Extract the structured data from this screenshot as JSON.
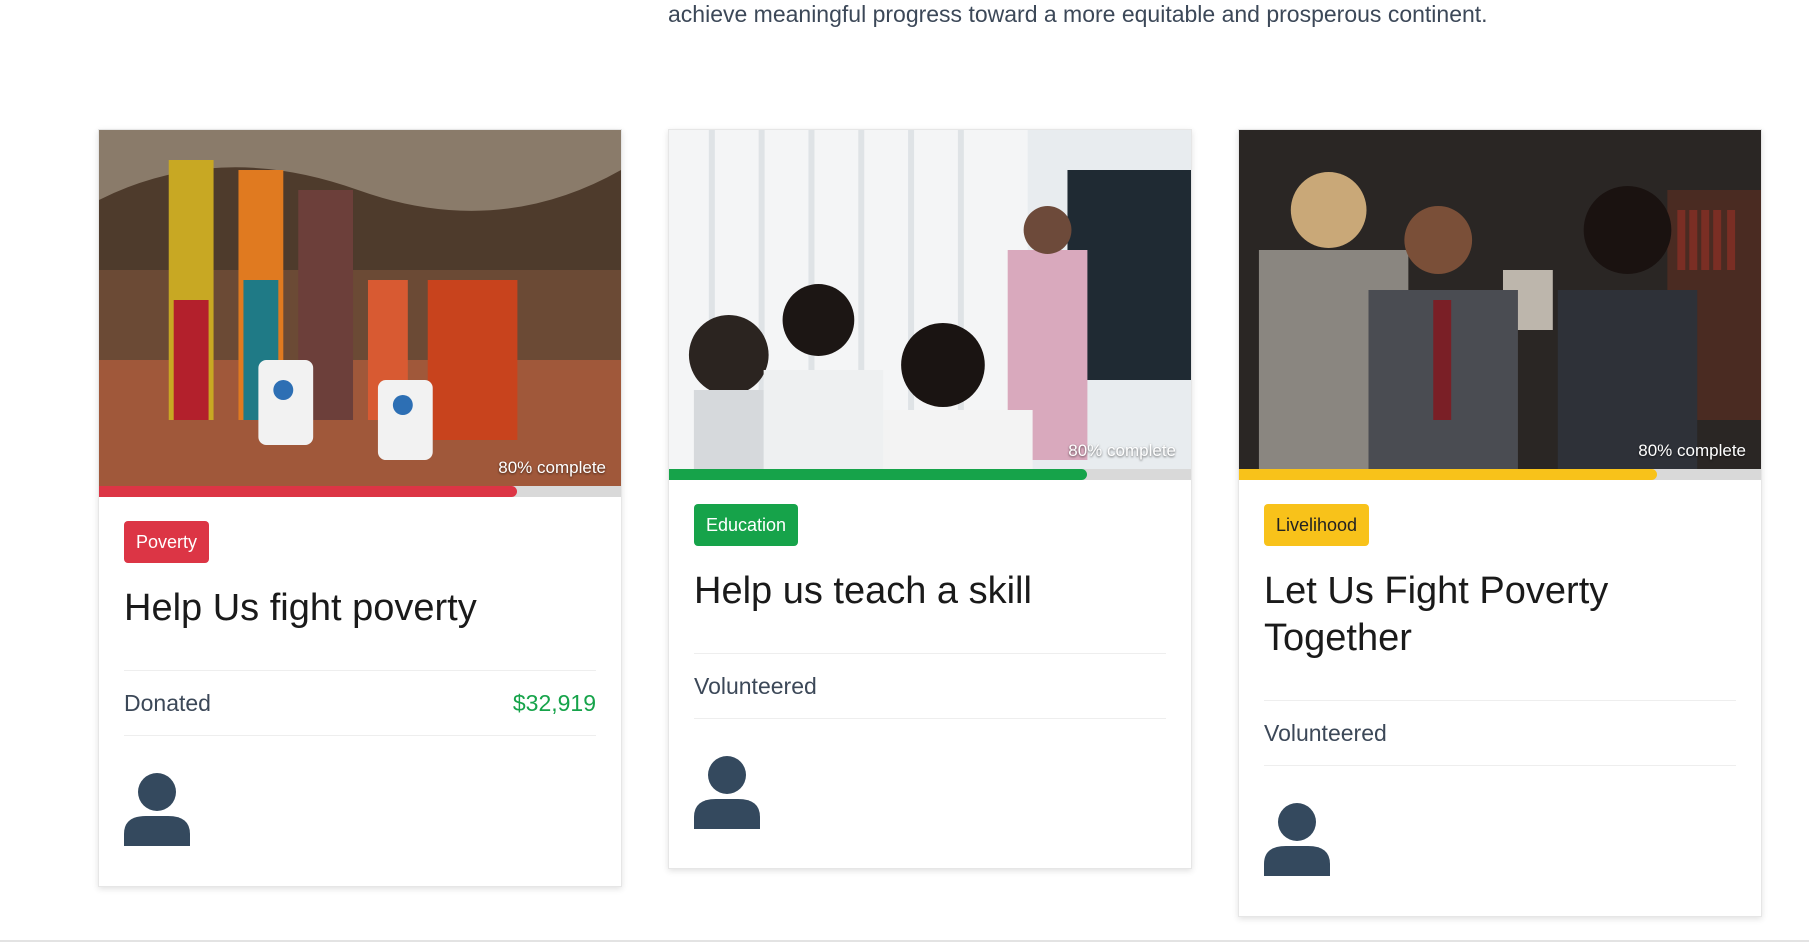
{
  "intro": {
    "text": "achieve meaningful progress toward a more equitable and prosperous continent."
  },
  "cards": [
    {
      "category": "Poverty",
      "title": "Help Us fight poverty",
      "progress_label": "80% complete",
      "progress_fraction": 0.8,
      "stat_label": "Donated",
      "stat_value": "$32,919",
      "image_alt": "women receiving food aid sacks",
      "accent_color": "#dc3545"
    },
    {
      "category": "Education",
      "title": "Help us teach a skill",
      "progress_label": "80% complete",
      "progress_fraction": 0.8,
      "stat_label": "Volunteered",
      "stat_value": "",
      "image_alt": "presenter teaching a small group",
      "accent_color": "#16a34a"
    },
    {
      "category": "Livelihood",
      "title": "Let Us Fight Poverty Together",
      "progress_label": "80% complete",
      "progress_fraction": 0.8,
      "stat_label": "Volunteered",
      "stat_value": "",
      "image_alt": "three professionals in discussion",
      "accent_color": "#f8c21a"
    }
  ],
  "icons": {
    "avatar": "user-icon"
  }
}
